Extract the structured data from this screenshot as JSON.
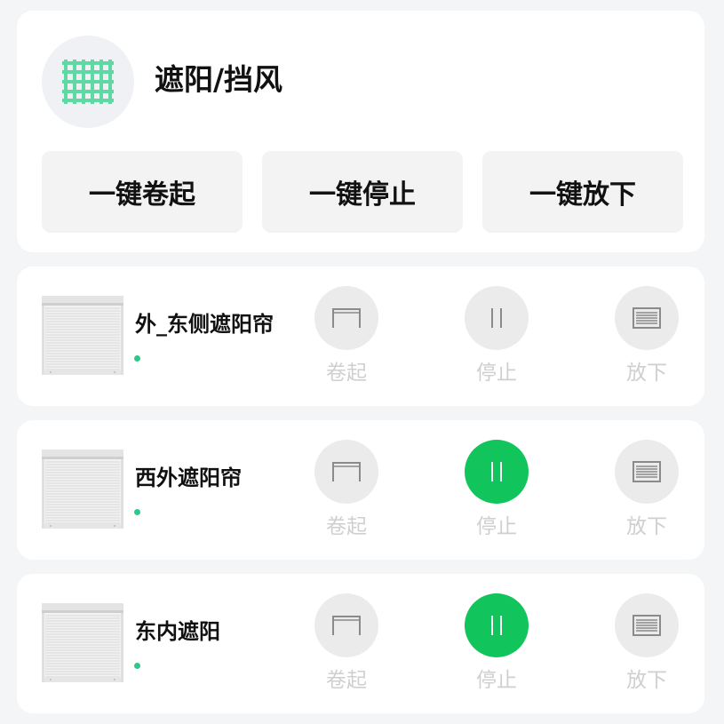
{
  "group": {
    "icon": "shade-net-icon",
    "title": "遮阳/挡风",
    "actions": {
      "roll_up": "一键卷起",
      "stop": "一键停止",
      "lower": "一键放下"
    }
  },
  "colors": {
    "accent_green": "#12c45c",
    "status_online": "#2ec98a",
    "icon_green": "#5fd9a3",
    "control_bg": "#ebebeb",
    "control_label": "#cfcfcf"
  },
  "devices": [
    {
      "name": "外_东侧遮阳帘",
      "icon": "roller-shutter-icon",
      "status": "online",
      "controls": {
        "up": "卷起",
        "stop": "停止",
        "down": "放下"
      },
      "active_control": "none"
    },
    {
      "name": "西外遮阳帘",
      "icon": "roller-shutter-icon",
      "status": "online",
      "controls": {
        "up": "卷起",
        "stop": "停止",
        "down": "放下"
      },
      "active_control": "stop"
    },
    {
      "name": "东内遮阳",
      "icon": "roller-shutter-icon",
      "status": "online",
      "controls": {
        "up": "卷起",
        "stop": "停止",
        "down": "放下"
      },
      "active_control": "stop"
    }
  ]
}
